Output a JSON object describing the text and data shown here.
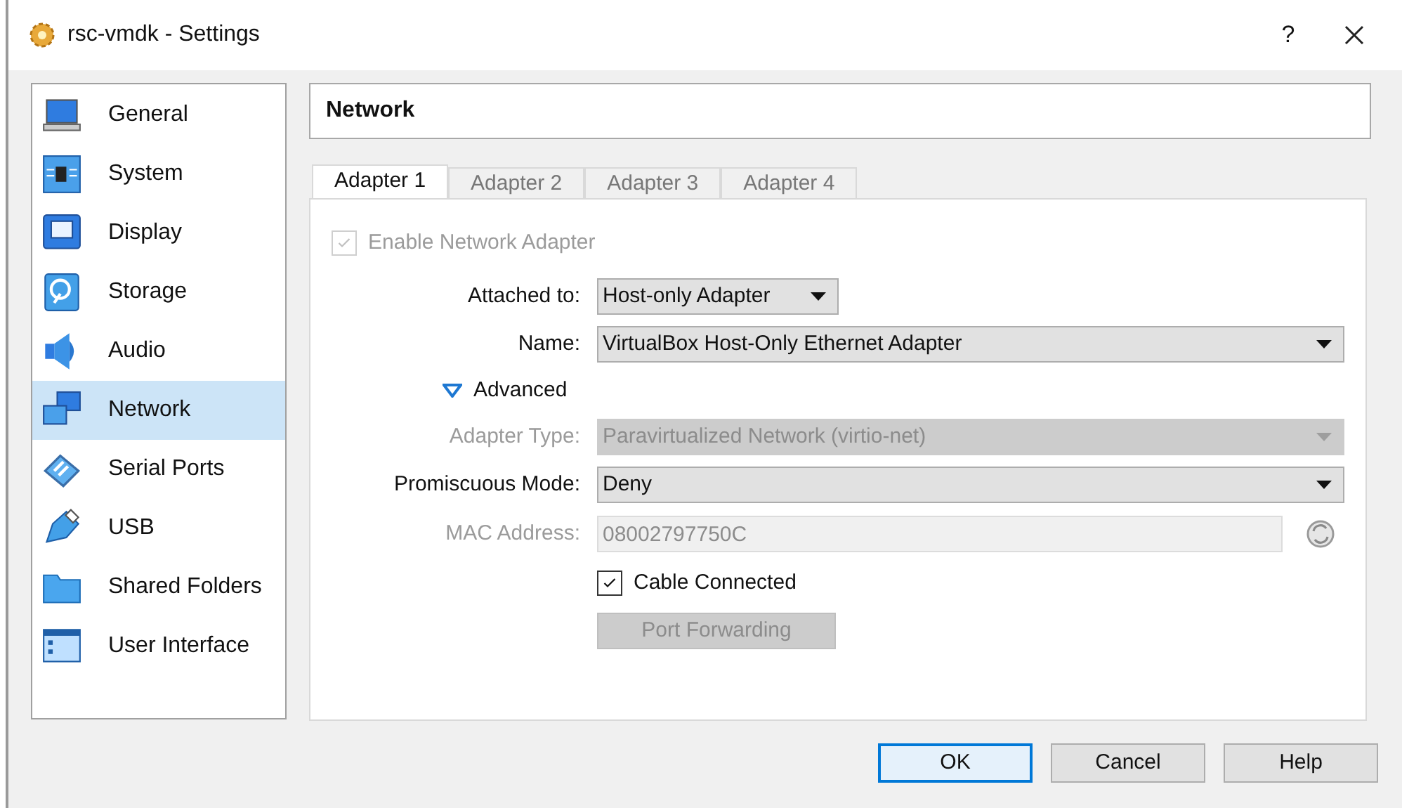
{
  "window": {
    "title": "rsc-vmdk - Settings",
    "help": "?"
  },
  "sidebar": {
    "items": [
      {
        "label": "General",
        "selected": false
      },
      {
        "label": "System",
        "selected": false
      },
      {
        "label": "Display",
        "selected": false
      },
      {
        "label": "Storage",
        "selected": false
      },
      {
        "label": "Audio",
        "selected": false
      },
      {
        "label": "Network",
        "selected": true
      },
      {
        "label": "Serial Ports",
        "selected": false
      },
      {
        "label": "USB",
        "selected": false
      },
      {
        "label": "Shared Folders",
        "selected": false
      },
      {
        "label": "User Interface",
        "selected": false
      }
    ]
  },
  "page_title": "Network",
  "tabs": [
    {
      "label": "Adapter 1",
      "selected": true
    },
    {
      "label": "Adapter 2",
      "selected": false
    },
    {
      "label": "Adapter 3",
      "selected": false
    },
    {
      "label": "Adapter 4",
      "selected": false
    }
  ],
  "rows": [
    {
      "kind": "checkbox",
      "label": "Enable Network Adapter",
      "checked": true,
      "disabled": true,
      "indent": false
    },
    {
      "kind": "dropdown-compact",
      "label": "Attached to:",
      "value": "Host-only Adapter",
      "disabled": false
    },
    {
      "kind": "dropdown",
      "label": "Name:",
      "value": "VirtualBox Host-Only Ethernet Adapter",
      "disabled": false
    },
    {
      "kind": "disclosure",
      "label": "Advanced",
      "expanded": true
    },
    {
      "kind": "dropdown",
      "label": "Adapter Type:",
      "value": "Paravirtualized Network (virtio-net)",
      "disabled": true
    },
    {
      "kind": "dropdown",
      "label": "Promiscuous Mode:",
      "value": "Deny",
      "disabled": false
    },
    {
      "kind": "text",
      "label": "MAC Address:",
      "value": "08002797750C",
      "disabled": true
    },
    {
      "kind": "checkbox",
      "label": "Cable Connected",
      "checked": true,
      "disabled": false,
      "indent": true
    },
    {
      "kind": "button",
      "label": "Port Forwarding",
      "disabled": true
    }
  ],
  "buttons": [
    {
      "label": "OK",
      "default": true
    },
    {
      "label": "Cancel",
      "default": false
    },
    {
      "label": "Help",
      "default": false
    }
  ]
}
